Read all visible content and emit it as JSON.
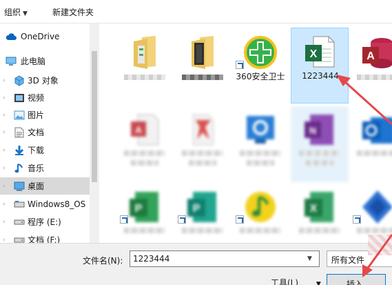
{
  "toolbar": {
    "organize_label": "组织",
    "new_folder_label": "新建文件夹"
  },
  "sidebar": {
    "items": [
      {
        "label": "OneDrive",
        "icon": "cloud-icon"
      },
      {
        "label": "此电脑",
        "icon": "computer-icon"
      },
      {
        "label": "3D 对象",
        "icon": "3d-objects-icon"
      },
      {
        "label": "视频",
        "icon": "video-icon"
      },
      {
        "label": "图片",
        "icon": "pictures-icon"
      },
      {
        "label": "文档",
        "icon": "documents-icon"
      },
      {
        "label": "下载",
        "icon": "download-icon"
      },
      {
        "label": "音乐",
        "icon": "music-icon"
      },
      {
        "label": "桌面",
        "icon": "desktop-icon"
      },
      {
        "label": "Windows8_OS",
        "icon": "drive-icon"
      },
      {
        "label": "程序 (E:)",
        "icon": "drive-icon"
      },
      {
        "label": "文档 (F:)",
        "icon": "drive-icon"
      }
    ]
  },
  "files": [
    {
      "name": "",
      "icon": "folder-icon"
    },
    {
      "name": "",
      "icon": "folder-icon"
    },
    {
      "name": "360安全卫士",
      "icon": "360-security-icon"
    },
    {
      "name": "1223444",
      "icon": "excel-file-icon"
    },
    {
      "name": "",
      "icon": "access-icon"
    }
  ],
  "bottom": {
    "filename_label": "文件名(N):",
    "filename_value": "1223444",
    "filetype_label": "所有文件",
    "tools_label": "工具(L)",
    "insert_label": "插入"
  },
  "colors": {
    "selection": "#cce8ff",
    "accent": "#0078d7",
    "arrow": "#e8474a",
    "excel": "#1d6f42"
  }
}
